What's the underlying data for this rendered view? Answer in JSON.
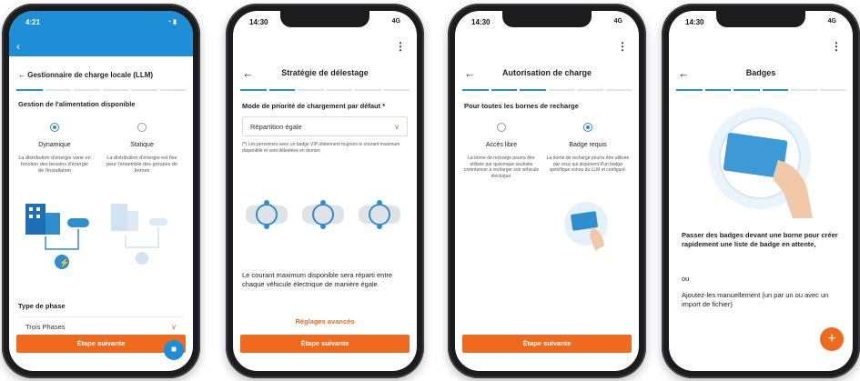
{
  "screens": [
    {
      "status_time": "4:21",
      "title": "← Gestionnaire de charge locale (LLM)",
      "section": "Gestion de l'alimentation disponible",
      "options": [
        {
          "label": "Dynamique",
          "desc": "La distribution d'énergie varie en fonction des besoins d'énergie de l'installation"
        },
        {
          "label": "Statique",
          "desc": "La distribution d'énergie est fixe pour l'ensemble des groupes de bornes"
        }
      ],
      "phase_label": "Type de phase",
      "phase_value": "Trois Phases",
      "cta": "Étape suivante"
    },
    {
      "status_time": "14:30",
      "status_right": "4G",
      "title": "Stratégie de délestage",
      "section": "Mode de priorité de chargement par défaut *",
      "select_value": "Répartition égale",
      "note": "(*) Les personnes avec un badge VIP obtiennent toujours le courant maximum disponible et sont délestées en dernier.",
      "body": "Le courant maximum disponible sera réparti entre chaque véhicule électrique de manière égale.",
      "link": "Réglages avancés",
      "cta": "Étape suivante"
    },
    {
      "status_time": "14:30",
      "status_right": "4G",
      "title": "Autorisation de charge",
      "section": "Pour toutes les bornes de recharge",
      "options": [
        {
          "label": "Accès libre",
          "desc": "La borne de recharge pourra être utilisée par quiconque souhaite commencer à recharger son véhicule électrique."
        },
        {
          "label": "Badge requis",
          "desc": "La borne de recharge pourra être utilisée par ceux qui disposent d'un badge spécifique connu du LLM et configuré."
        }
      ],
      "cta": "Étape suivante"
    },
    {
      "status_time": "14:30",
      "status_right": "4G",
      "title": "Badges",
      "text1": "Passer des badges devant une borne pour créer rapidement une liste de badge en attente,",
      "text2": "ou",
      "text3": "Ajoutez-les manuellement (un par un ou avec un import de fichier)",
      "fab": "+"
    }
  ],
  "colors": {
    "accent": "#ef6a1f",
    "blue": "#2f8fce"
  }
}
